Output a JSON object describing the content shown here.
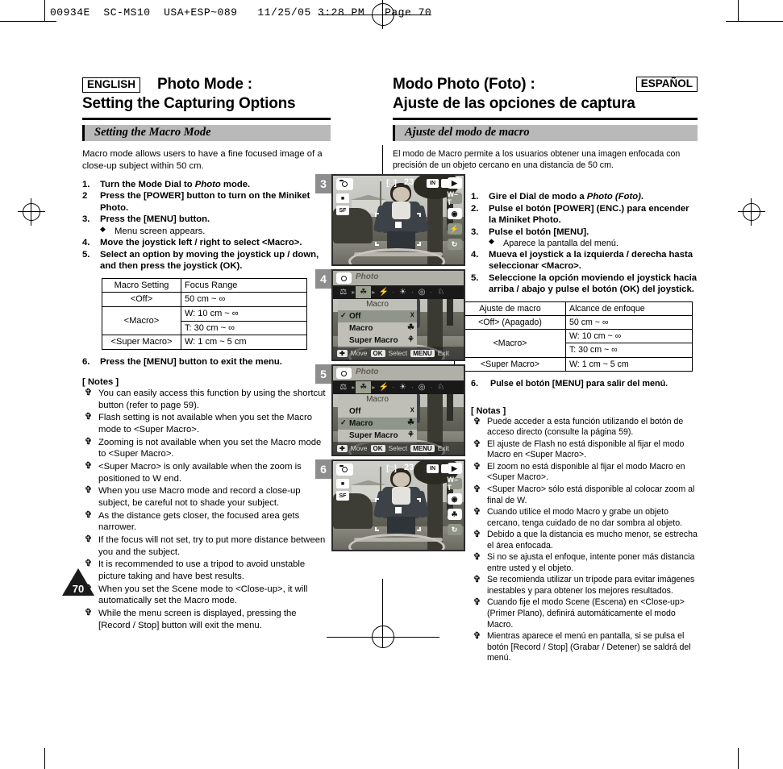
{
  "slug": "00934E  SC-MS10  USA+ESP~089   11/25/05 3:28 PM   Page 70",
  "page_number": "70",
  "english": {
    "lang_badge": "ENGLISH",
    "title_line1": "Photo Mode :",
    "title_line2": "Setting the Capturing Options",
    "section": "Setting the Macro Mode",
    "intro": "Macro mode allows users to have a fine focused image of a close-up subject within 50 cm.",
    "steps": [
      {
        "num": "1.",
        "pre": "Turn the Mode Dial to ",
        "em": "Photo",
        "post": " mode."
      },
      {
        "num": "2",
        "pre": "Press the [POWER] button to turn on the Miniket Photo.",
        "em": "",
        "post": ""
      },
      {
        "num": "3.",
        "pre": "Press the [MENU] button.",
        "em": "",
        "post": ""
      }
    ],
    "sub_bullet": "Menu screen appears.",
    "steps2": [
      {
        "num": "4.",
        "text": "Move the joystick left / right to select <Macro>."
      },
      {
        "num": "5.",
        "text": "Select an option by moving the joystick up / down, and then press the joystick (OK)."
      }
    ],
    "table": {
      "headers": [
        "Macro Setting",
        "Focus Range"
      ],
      "rows": [
        {
          "setting": "<Off>",
          "ranges": [
            "50 cm ~ ∞"
          ]
        },
        {
          "setting": "<Macro>",
          "ranges": [
            "W: 10 cm ~ ∞",
            "T: 30 cm ~ ∞"
          ]
        },
        {
          "setting": "<Super Macro>",
          "ranges": [
            "W: 1 cm ~ 5 cm"
          ]
        }
      ]
    },
    "step6": {
      "num": "6.",
      "text": "Press the [MENU] button to exit the menu."
    },
    "notes_title": "[ Notes ]",
    "notes": [
      "You can easily access this function by using the shortcut button (refer to page 59).",
      "Flash setting is not available when you set the Macro mode to <Super Macro>.",
      "Zooming is not available when you set the Macro mode to <Super Macro>.",
      "<Super Macro> is only available when the zoom is positioned to W end.",
      "When you use Macro mode and record a close-up subject, be careful not to shade your subject.",
      "As the distance gets closer, the focused area gets narrower.",
      "If the focus will not set, try to put more distance between you and the subject.",
      "It is recommended to use a tripod to avoid unstable picture taking and have best results.",
      "When you set the Scene mode to <Close-up>, it will automatically set the Macro mode.",
      "While the menu screen is displayed, pressing the [Record / Stop] button will exit the menu."
    ]
  },
  "spanish": {
    "lang_badge": "ESPAÑOL",
    "title_line1": "Modo Photo (Foto) :",
    "title_line2": "Ajuste de las opciones de captura",
    "section": "Ajuste del modo de macro",
    "intro": "El modo de Macro permite a los usuarios obtener una imagen enfocada con precisión de un objeto cercano en una distancia de 50 cm.",
    "steps": [
      {
        "num": "1.",
        "pre": "Gire el Dial de modo a ",
        "em": "Photo (Foto)",
        "post": "."
      },
      {
        "num": "2.",
        "pre": "Pulse el botón [POWER] (ENC.) para encender la Miniket Photo.",
        "em": "",
        "post": ""
      },
      {
        "num": "3.",
        "pre": "Pulse el botón [MENU].",
        "em": "",
        "post": ""
      }
    ],
    "sub_bullet": "Aparece la pantalla del menú.",
    "steps2": [
      {
        "num": "4.",
        "text": "Mueva el joystick a la izquierda / derecha hasta seleccionar <Macro>."
      },
      {
        "num": "5.",
        "text": "Seleccione la opción moviendo el joystick hacia arriba / abajo y pulse el botón (OK) del joystick."
      }
    ],
    "table": {
      "headers": [
        "Ajuste de macro",
        "Alcance de enfoque"
      ],
      "rows": [
        {
          "setting": "<Off> (Apagado)",
          "ranges": [
            "50 cm ~ ∞"
          ]
        },
        {
          "setting": "<Macro>",
          "ranges": [
            "W: 10 cm ~ ∞",
            "T: 30 cm ~ ∞"
          ]
        },
        {
          "setting": "<Super Macro>",
          "ranges": [
            "W: 1 cm ~ 5 cm"
          ]
        }
      ]
    },
    "step6": {
      "num": "6.",
      "text": "Pulse el botón [MENU] para salir del menú."
    },
    "notes_title": "[ Notas ]",
    "notes": [
      "Puede acceder a esta función utilizando el botón de acceso directo (consulte la página 59).",
      "El ajuste de Flash no está disponible al fijar el modo Macro en <Super Macro>.",
      "El zoom no está disponible al fijar el modo Macro en <Super Macro>.",
      "<Super Macro> sólo está disponible al colocar zoom al final de W.",
      "Cuando utilice el modo Macro y grabe un objeto cercano, tenga cuidado de no dar sombra al objeto.",
      "Debido a que la distancia es mucho menor, se estrecha el área enfocada.",
      "Si no se ajusta el enfoque, intente poner más distancia entre usted y el objeto.",
      "Se recomienda utilizar un trípode para evitar imágenes inestables y para obtener los mejores resultados.",
      "Cuando fije el modo Scene (Escena) en <Close-up> (Primer Plano), definirá automáticamente el modo Macro.",
      "Mientras aparece el menú en pantalla, si se pulsa el botón [Record / Stop] (Grabar / Detener) se saldrá del menú."
    ]
  },
  "figures": [
    {
      "step": "3",
      "type": "live",
      "osd": {
        "counter": "23",
        "storage": "IN",
        "focus_icon": "[□]",
        "mode_icon": "camera-icon",
        "left_icons": [
          "resolution-icon",
          "quality-icon"
        ],
        "right_icons": [
          "playback-icon",
          "zoom-w-t-icon",
          "ev-icon",
          "flash-off-icon",
          "self-timer-icon"
        ]
      }
    },
    {
      "step": "4",
      "type": "menu",
      "header_title": "Photo",
      "submenu_title": "Macro",
      "tabs": [
        "scene-icon",
        "macro-icon",
        "flash-icon",
        "ev-icon",
        "focus-icon",
        "wb-icon"
      ],
      "selected_tab_index": 1,
      "options": [
        {
          "label": "Off",
          "selected": true,
          "icon": "macro-off-icon"
        },
        {
          "label": "Macro",
          "selected": false,
          "icon": "macro-icon"
        },
        {
          "label": "Super Macro",
          "selected": false,
          "icon": "super-macro-icon"
        }
      ],
      "footer": {
        "move": "Move",
        "ok": "OK",
        "select": "Select",
        "menu": "MENU",
        "exit": "Exit"
      }
    },
    {
      "step": "5",
      "type": "menu",
      "header_title": "Photo",
      "submenu_title": "Macro",
      "tabs": [
        "scene-icon",
        "macro-icon",
        "flash-icon",
        "ev-icon",
        "focus-icon",
        "wb-icon"
      ],
      "selected_tab_index": 1,
      "options": [
        {
          "label": "Off",
          "selected": false,
          "icon": "macro-off-icon"
        },
        {
          "label": "Macro",
          "selected": true,
          "icon": "macro-icon"
        },
        {
          "label": "Super Macro",
          "selected": false,
          "icon": "super-macro-icon"
        }
      ],
      "footer": {
        "move": "Move",
        "ok": "OK",
        "select": "Select",
        "menu": "MENU",
        "exit": "Exit"
      }
    },
    {
      "step": "6",
      "type": "live",
      "osd": {
        "counter": "23",
        "storage": "IN",
        "focus_icon": "[□]",
        "mode_icon": "camera-icon",
        "left_icons": [
          "resolution-icon",
          "quality-icon"
        ],
        "right_icons": [
          "playback-icon",
          "zoom-w-t-icon",
          "ev-icon",
          "macro-icon",
          "self-timer-icon"
        ]
      }
    }
  ],
  "colors": {
    "section_bar": "#b9b9b9",
    "fig_num_bg": "#8d8d8d",
    "rule": "#000000"
  }
}
